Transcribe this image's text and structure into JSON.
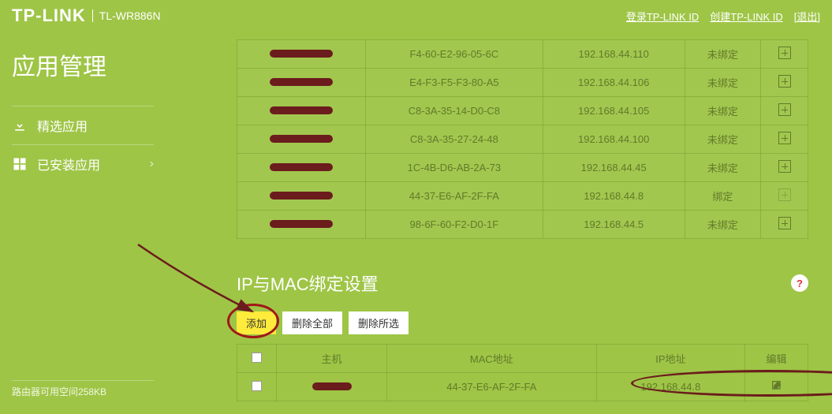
{
  "header": {
    "brand": "TP-LINK",
    "model": "TL-WR886N",
    "links": {
      "login": "登录TP-LINK ID",
      "create": "创建TP-LINK ID",
      "logout": "[退出]"
    }
  },
  "sidebar": {
    "title": "应用管理",
    "featured": "精选应用",
    "installed": "已安装应用"
  },
  "devices": [
    {
      "mac": "F4-60-E2-96-05-6C",
      "ip": "192.168.44.110",
      "status": "未绑定"
    },
    {
      "mac": "E4-F3-F5-F3-80-A5",
      "ip": "192.168.44.106",
      "status": "未绑定"
    },
    {
      "mac": "C8-3A-35-14-D0-C8",
      "ip": "192.168.44.105",
      "status": "未绑定"
    },
    {
      "mac": "C8-3A-35-27-24-48",
      "ip": "192.168.44.100",
      "status": "未绑定"
    },
    {
      "mac": "1C-4B-D6-AB-2A-73",
      "ip": "192.168.44.45",
      "status": "未绑定"
    },
    {
      "mac": "44-37-E6-AF-2F-FA",
      "ip": "192.168.44.8",
      "status": "绑定"
    },
    {
      "mac": "98-6F-60-F2-D0-1F",
      "ip": "192.168.44.5",
      "status": "未绑定"
    }
  ],
  "section": {
    "title": "IP与MAC绑定设置",
    "help": "?",
    "add": "添加",
    "delete_all": "删除全部",
    "delete_selected": "删除所选"
  },
  "binding_headers": {
    "host": "主机",
    "mac": "MAC地址",
    "ip": "IP地址",
    "edit": "编辑"
  },
  "binding_row": {
    "mac": "44-37-E6-AF-2F-FA",
    "ip": "192.168.44.8"
  },
  "footer": "路由器可用空间258KB"
}
